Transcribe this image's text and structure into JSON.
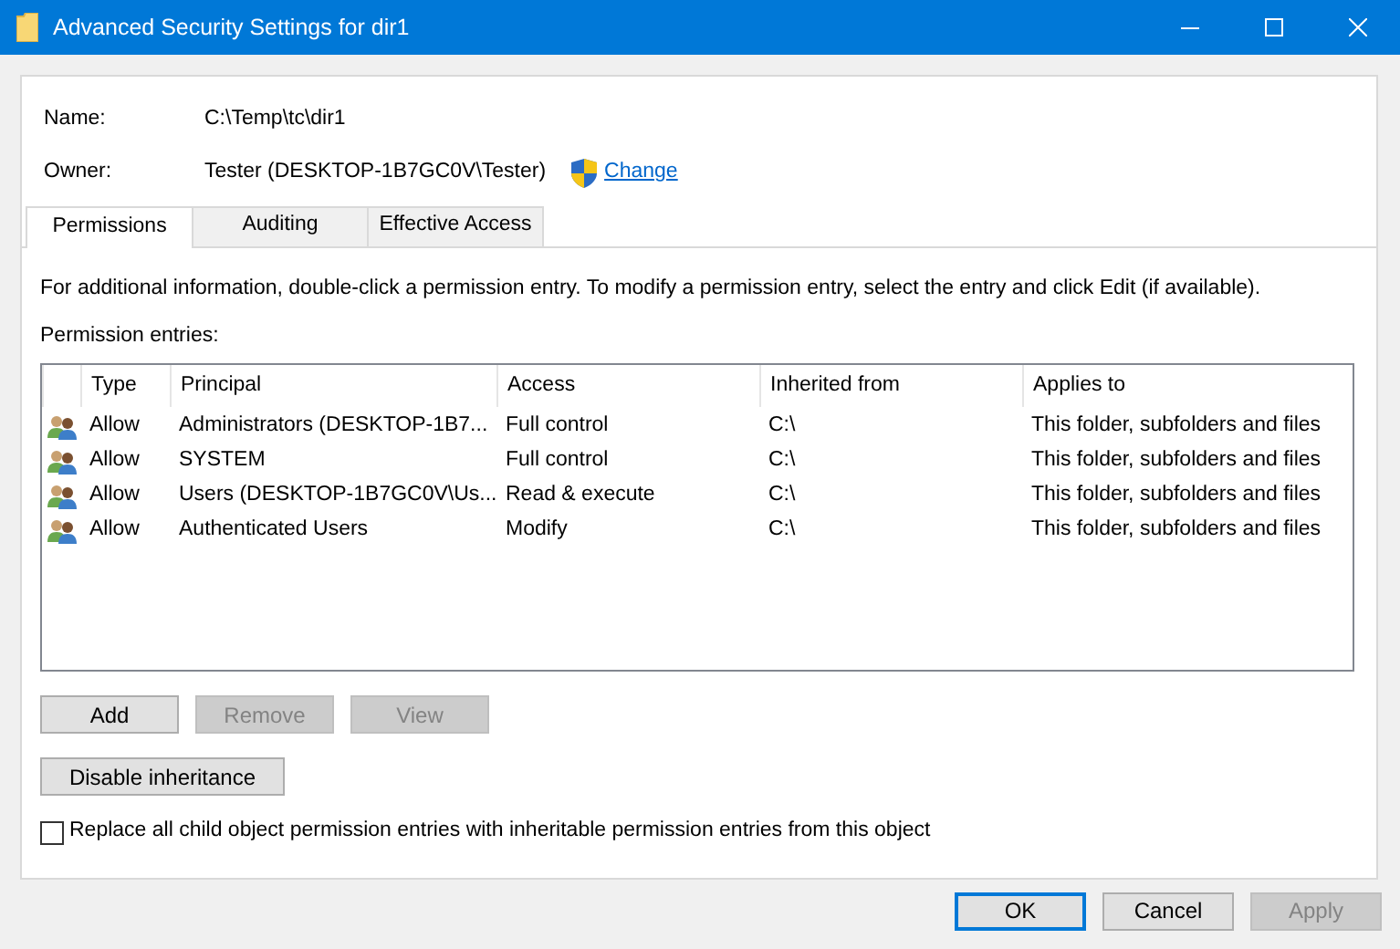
{
  "window": {
    "title": "Advanced Security Settings for dir1"
  },
  "name": {
    "label": "Name:",
    "value": "C:\\Temp\\tc\\dir1"
  },
  "owner": {
    "label": "Owner:",
    "value": "Tester (DESKTOP-1B7GC0V\\Tester)",
    "change_link": "Change"
  },
  "tabs": [
    {
      "label": "Permissions",
      "selected": true
    },
    {
      "label": "Auditing",
      "selected": false
    },
    {
      "label": "Effective Access",
      "selected": false
    }
  ],
  "info_text": "For additional information, double-click a permission entry. To modify a permission entry, select the entry and click Edit (if available).",
  "entries_label": "Permission entries:",
  "table": {
    "columns": [
      "Type",
      "Principal",
      "Access",
      "Inherited from",
      "Applies to"
    ],
    "rows": [
      {
        "cells": [
          "Allow",
          "Administrators (DESKTOP-1B7...",
          "Full control",
          "C:\\",
          "This folder, subfolders and files"
        ]
      },
      {
        "cells": [
          "Allow",
          "SYSTEM",
          "Full control",
          "C:\\",
          "This folder, subfolders and files"
        ]
      },
      {
        "cells": [
          "Allow",
          "Users (DESKTOP-1B7GC0V\\Us...",
          "Read & execute",
          "C:\\",
          "This folder, subfolders and files"
        ]
      },
      {
        "cells": [
          "Allow",
          "Authenticated Users",
          "Modify",
          "C:\\",
          "This folder, subfolders and files"
        ]
      }
    ]
  },
  "entry_buttons": [
    {
      "label": "Add",
      "disabled": false
    },
    {
      "label": "Remove",
      "disabled": true
    },
    {
      "label": "View",
      "disabled": true
    }
  ],
  "inheritance_button": {
    "label": "Disable inheritance",
    "disabled": false
  },
  "replace_checkbox": {
    "label": "Replace all child object permission entries with inheritable permission entries from this object",
    "checked": false
  },
  "buttons": [
    {
      "label": "OK",
      "default": true,
      "disabled": false
    },
    {
      "label": "Cancel",
      "default": false,
      "disabled": false
    },
    {
      "label": "Apply",
      "default": false,
      "disabled": true
    }
  ]
}
